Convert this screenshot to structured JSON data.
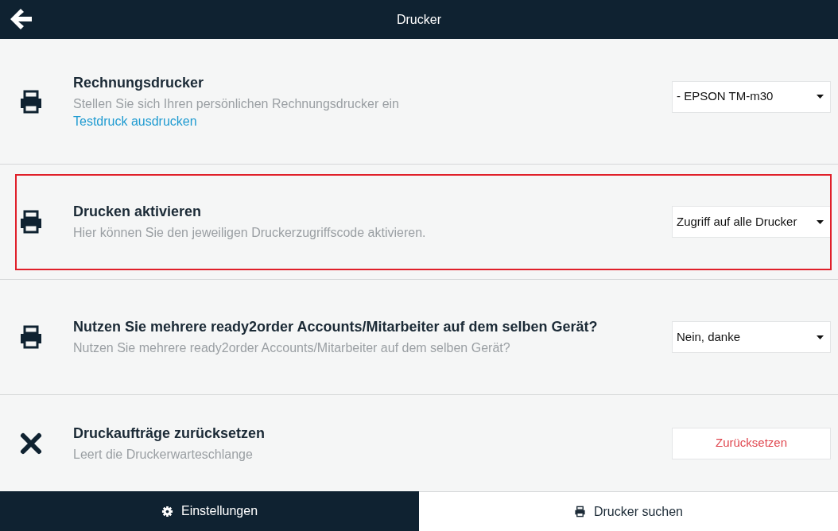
{
  "header": {
    "title": "Drucker"
  },
  "sections": [
    {
      "kind": "printer",
      "title": "Rechnungsdrucker",
      "description": "Stellen Sie sich Ihren persönlichen Rechnungsdrucker ein",
      "link": "Testdruck ausdrucken",
      "control": {
        "kind": "dropdown",
        "value": "- EPSON TM-m30"
      },
      "highlighted": false
    },
    {
      "kind": "printer",
      "title": "Drucken aktivieren",
      "description": "Hier können Sie den jeweiligen Druckerzugriffscode aktivieren.",
      "control": {
        "kind": "dropdown",
        "value": "Zugriff auf alle Drucker"
      },
      "highlighted": true
    },
    {
      "kind": "printer",
      "title": "Nutzen Sie mehrere ready2order Accounts/Mitarbeiter auf dem selben Gerät?",
      "description": "Nutzen Sie mehrere ready2order Accounts/Mitarbeiter auf dem selben Gerät?",
      "control": {
        "kind": "dropdown",
        "value": "Nein, danke"
      },
      "highlighted": false
    },
    {
      "kind": "cross",
      "title": "Druckaufträge zurücksetzen",
      "description": "Leert die Druckerwarteschlange",
      "control": {
        "kind": "button",
        "value": "Zurücksetzen"
      },
      "highlighted": false
    }
  ],
  "footer_tabs": [
    {
      "kind": "gear",
      "label": "Einstellungen",
      "selected": true
    },
    {
      "kind": "printer",
      "label": "Drucker suchen",
      "selected": false
    }
  ]
}
